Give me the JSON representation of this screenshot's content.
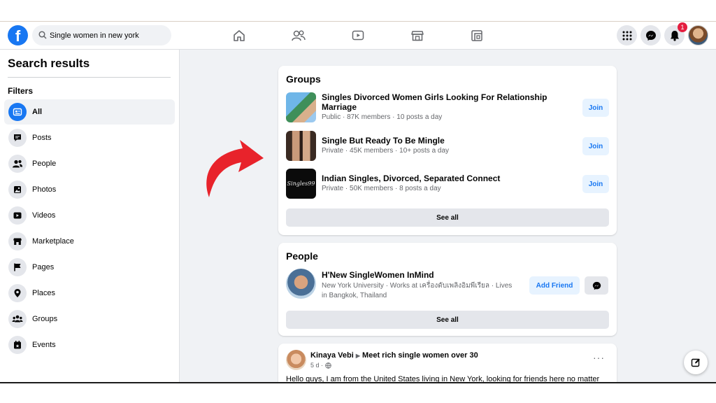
{
  "topbar": {
    "search_value": "Single women in new york",
    "notification_count": "1"
  },
  "sidebar": {
    "title": "Search results",
    "filters_label": "Filters",
    "items": [
      {
        "label": "All",
        "icon": "all-icon",
        "active": true
      },
      {
        "label": "Posts",
        "icon": "posts-icon"
      },
      {
        "label": "People",
        "icon": "people-icon"
      },
      {
        "label": "Photos",
        "icon": "photos-icon"
      },
      {
        "label": "Videos",
        "icon": "videos-icon"
      },
      {
        "label": "Marketplace",
        "icon": "marketplace-icon"
      },
      {
        "label": "Pages",
        "icon": "pages-icon"
      },
      {
        "label": "Places",
        "icon": "places-icon"
      },
      {
        "label": "Groups",
        "icon": "groups-icon"
      },
      {
        "label": "Events",
        "icon": "events-icon"
      }
    ]
  },
  "groups": {
    "title": "Groups",
    "items": [
      {
        "name": "Singles Divorced Women Girls Looking For Relationship Marriage",
        "meta": "Public · 87K members · 10 posts a day",
        "join": "Join"
      },
      {
        "name": "Single But Ready To Be Mingle",
        "meta": "Private · 45K members · 10+ posts a day",
        "join": "Join"
      },
      {
        "name": "Indian Singles, Divorced, Separated Connect",
        "meta": "Private · 50K members · 8 posts a day",
        "join": "Join",
        "thumb_text": "Singles99"
      }
    ],
    "see_all": "See all"
  },
  "people": {
    "title": "People",
    "person": {
      "name": "H'New SingleWomen InMind",
      "meta": "New York University · Works at เครื่องดับเพลิงอิมพีเรียล · Lives in Bangkok, Thailand",
      "add_friend": "Add Friend"
    },
    "see_all": "See all"
  },
  "post": {
    "author": "Kinaya Vebi",
    "group": "Meet rich single women over 30",
    "time": "5 d ·",
    "more": "···",
    "text": "Hello guys, I am from the United States living in New York, looking for friends here no matter"
  },
  "colors": {
    "brand": "#1877f2",
    "arrow": "#e8232b",
    "badge": "#e41e3f"
  }
}
